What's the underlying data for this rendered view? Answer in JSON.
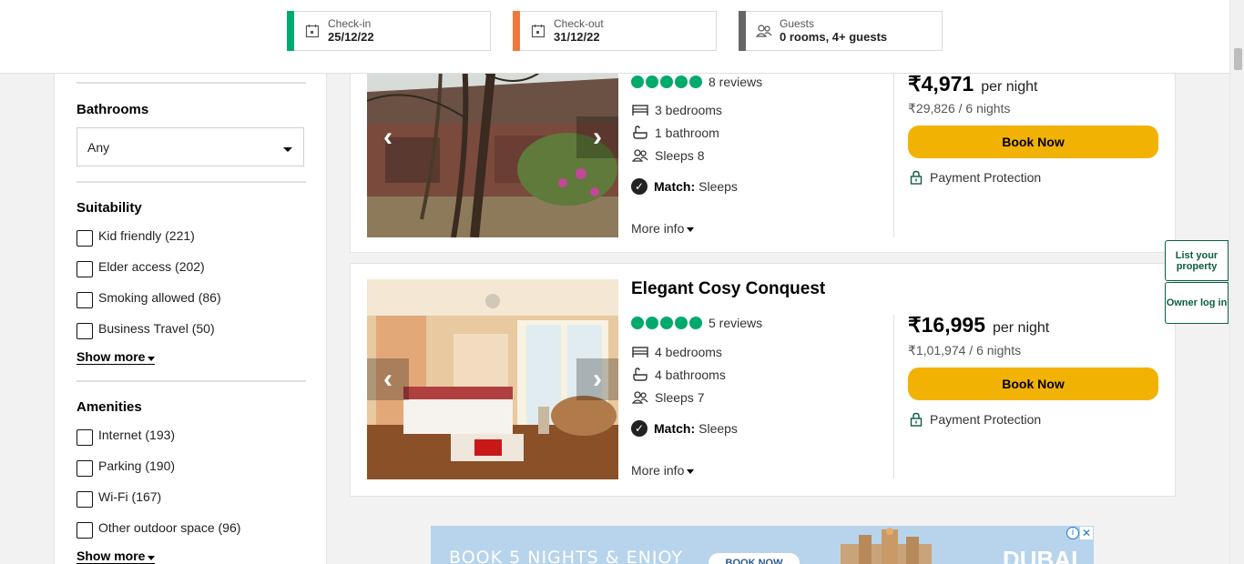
{
  "header": {
    "checkin": {
      "label": "Check-in",
      "value": "25/12/22",
      "color": "#00aa6c"
    },
    "checkout": {
      "label": "Check-out",
      "value": "31/12/22",
      "color": "#f2783a"
    },
    "guests": {
      "label": "Guests",
      "value": "0 rooms, 4+ guests",
      "color": "#666666"
    }
  },
  "sidebar": {
    "bathrooms": {
      "title": "Bathrooms",
      "selected": "Any"
    },
    "suitability": {
      "title": "Suitability",
      "options": [
        "Kid friendly (221)",
        "Elder access (202)",
        "Smoking allowed (86)",
        "Business Travel (50)"
      ],
      "show_more": "Show more"
    },
    "amenities": {
      "title": "Amenities",
      "options": [
        "Internet (193)",
        "Parking (190)",
        "Wi-Fi (167)",
        "Other outdoor space (96)"
      ],
      "show_more": "Show more"
    }
  },
  "listings": [
    {
      "title": "",
      "reviews": "8 reviews",
      "bedrooms": "3 bedrooms",
      "bathrooms": "1 bathroom",
      "sleeps": "Sleeps 8",
      "match_label": "Match:",
      "match_value": "Sleeps",
      "more_info": "More info",
      "price": "₹4,971",
      "per_night": "per night",
      "total": "₹29,826 / 6 nights",
      "book": "Book Now",
      "protection": "Payment Protection"
    },
    {
      "title": "Elegant Cosy Conquest",
      "reviews": "5 reviews",
      "bedrooms": "4 bedrooms",
      "bathrooms": "4 bathrooms",
      "sleeps": "Sleeps 7",
      "match_label": "Match:",
      "match_value": "Sleeps",
      "more_info": "More info",
      "price": "₹16,995",
      "per_night": "per night",
      "total": "₹1,01,974 / 6 nights",
      "book": "Book Now",
      "protection": "Payment Protection"
    }
  ],
  "floating": {
    "list_property": "List your property",
    "owner_login": "Owner log in"
  },
  "ad": {
    "headline": "BOOK 5 NIGHTS & ENJOY",
    "button": "BOOK NOW",
    "brand": "DUBAI"
  },
  "colors": {
    "accent_green": "#00aa6c",
    "book_yellow": "#f2b203",
    "owner_green": "#0b5d44"
  }
}
